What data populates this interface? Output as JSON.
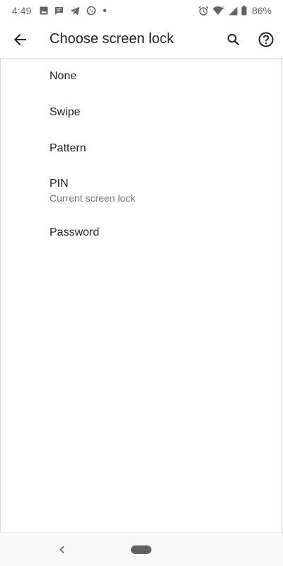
{
  "status_bar": {
    "time": "4:49",
    "battery_percent": "86%",
    "left_icons": [
      "image-icon",
      "message-icon",
      "telegram-icon",
      "whatsapp-icon",
      "dot-icon"
    ],
    "right_icons": [
      "alarm-icon",
      "wifi-icon",
      "signal-icon",
      "battery-icon"
    ]
  },
  "toolbar": {
    "title": "Choose screen lock",
    "back_icon": "arrow-back-icon",
    "search_icon": "search-icon",
    "help_icon": "help-icon"
  },
  "lock_options": [
    {
      "label": "None",
      "summary": ""
    },
    {
      "label": "Swipe",
      "summary": ""
    },
    {
      "label": "Pattern",
      "summary": ""
    },
    {
      "label": "PIN",
      "summary": "Current screen lock"
    },
    {
      "label": "Password",
      "summary": ""
    }
  ],
  "nav_bar": {
    "back_icon": "nav-back-icon",
    "home_icon": "nav-home-pill"
  },
  "colors": {
    "text_primary": "#202124",
    "text_secondary": "#70757a",
    "icon": "#5f6368",
    "background": "#ffffff"
  }
}
